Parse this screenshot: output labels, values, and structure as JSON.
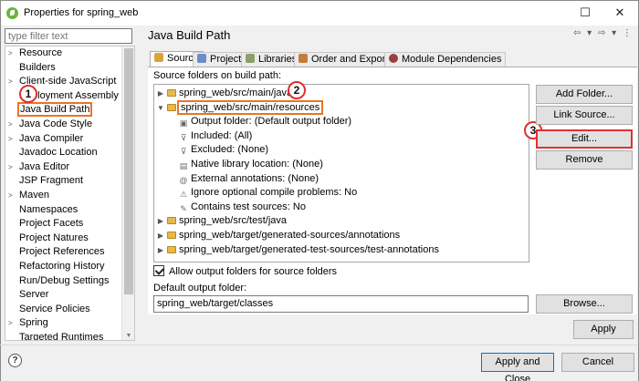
{
  "window": {
    "title": "Properties for spring_web"
  },
  "filter": {
    "placeholder": "type filter text"
  },
  "nav_items": [
    {
      "label": "Resource",
      "expandable": true
    },
    {
      "label": "Builders",
      "expandable": false
    },
    {
      "label": "Client-side JavaScript",
      "expandable": true
    },
    {
      "label": "Deployment Assembly",
      "expandable": false
    },
    {
      "label": "Java Build Path",
      "expandable": false,
      "selected": true
    },
    {
      "label": "Java Code Style",
      "expandable": true
    },
    {
      "label": "Java Compiler",
      "expandable": true
    },
    {
      "label": "Javadoc Location",
      "expandable": false
    },
    {
      "label": "Java Editor",
      "expandable": true
    },
    {
      "label": "JSP Fragment",
      "expandable": false
    },
    {
      "label": "Maven",
      "expandable": true
    },
    {
      "label": "Namespaces",
      "expandable": false
    },
    {
      "label": "Project Facets",
      "expandable": false
    },
    {
      "label": "Project Natures",
      "expandable": false
    },
    {
      "label": "Project References",
      "expandable": false
    },
    {
      "label": "Refactoring History",
      "expandable": false
    },
    {
      "label": "Run/Debug Settings",
      "expandable": false
    },
    {
      "label": "Server",
      "expandable": false
    },
    {
      "label": "Service Policies",
      "expandable": false
    },
    {
      "label": "Spring",
      "expandable": true
    },
    {
      "label": "Targeted Runtimes",
      "expandable": false
    }
  ],
  "page": {
    "title": "Java Build Path"
  },
  "tabs": [
    {
      "label": "Source",
      "active": true
    },
    {
      "label": "Projects"
    },
    {
      "label": "Libraries"
    },
    {
      "label": "Order and Export"
    },
    {
      "label": "Module Dependencies"
    }
  ],
  "source": {
    "label": "Source folders on build path:",
    "tree": [
      {
        "text": "spring_web/src/main/java",
        "type": "folder",
        "expander": "▶",
        "depth": 0
      },
      {
        "text": "spring_web/src/main/resources",
        "type": "folder",
        "expander": "▼",
        "depth": 0,
        "highlight": true
      },
      {
        "text": "Output folder: (Default output folder)",
        "type": "attr",
        "icon": "output-folder-icon",
        "depth": 1
      },
      {
        "text": "Included: (All)",
        "type": "attr",
        "icon": "filter-icon",
        "depth": 1
      },
      {
        "text": "Excluded: (None)",
        "type": "attr",
        "icon": "filter-icon",
        "depth": 1
      },
      {
        "text": "Native library location: (None)",
        "type": "attr",
        "icon": "library-icon",
        "depth": 1
      },
      {
        "text": "External annotations: (None)",
        "type": "attr",
        "icon": "annotation-icon",
        "depth": 1
      },
      {
        "text": "Ignore optional compile problems: No",
        "type": "attr",
        "icon": "warning-icon",
        "depth": 1
      },
      {
        "text": "Contains test sources: No",
        "type": "attr",
        "icon": "test-icon",
        "depth": 1
      },
      {
        "text": "spring_web/src/test/java",
        "type": "folder",
        "expander": "▶",
        "depth": 0
      },
      {
        "text": "spring_web/target/generated-sources/annotations",
        "type": "folder",
        "expander": "▶",
        "depth": 0
      },
      {
        "text": "spring_web/target/generated-test-sources/test-annotations",
        "type": "folder",
        "expander": "▶",
        "depth": 0
      }
    ],
    "buttons": {
      "add_folder": "Add Folder...",
      "link_source": "Link Source...",
      "edit": "Edit...",
      "remove": "Remove"
    },
    "allow_output": {
      "label": "Allow output folders for source folders",
      "checked": true
    },
    "default_output": {
      "label": "Default output folder:",
      "value": "spring_web/target/classes",
      "browse": "Browse..."
    }
  },
  "callouts": [
    "1",
    "2",
    "3"
  ],
  "footer": {
    "apply": "Apply",
    "apply_and_close": "Apply and Close",
    "cancel": "Cancel",
    "help": "?"
  },
  "colors": {
    "highlight": "#e8742a",
    "callout": "#e03030"
  }
}
